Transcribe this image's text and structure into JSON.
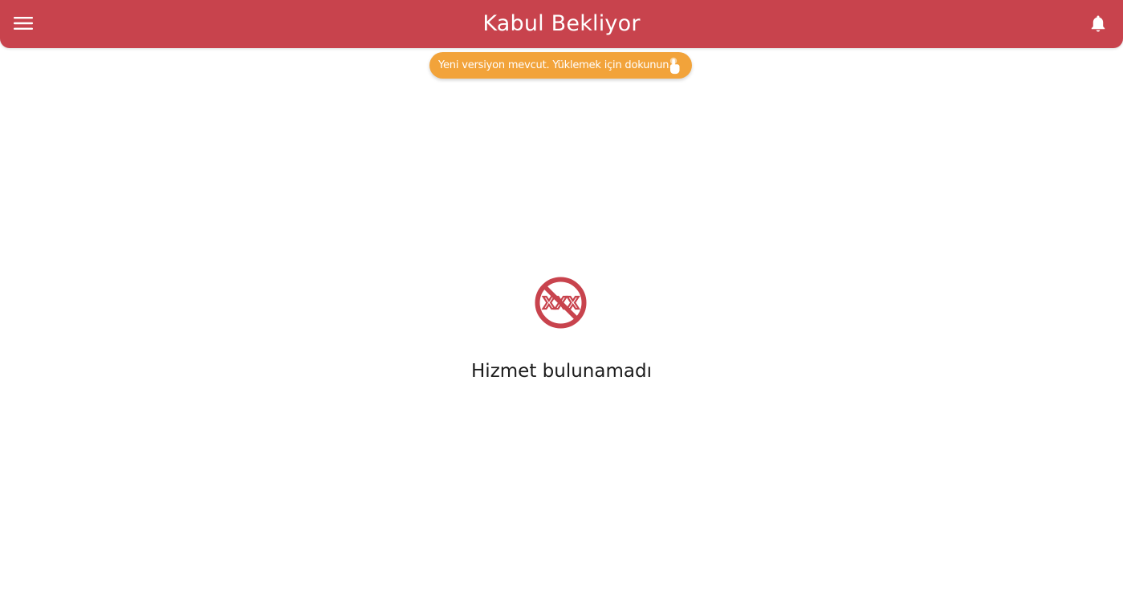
{
  "header": {
    "title": "Kabul Bekliyor",
    "menu_icon": "hamburger-menu-icon",
    "notification_icon": "bell-icon",
    "background_color": "#c8434d"
  },
  "update_banner": {
    "text": "Yeni versiyon mevcut. Yüklemek için dokunun...",
    "icon": "tap-hand-icon",
    "background_color": "#f2a33a"
  },
  "empty_state": {
    "icon": "no-service-icon",
    "icon_text": "XXX",
    "message": "Hizmet bulunamadı",
    "icon_color": "#c8434d"
  }
}
